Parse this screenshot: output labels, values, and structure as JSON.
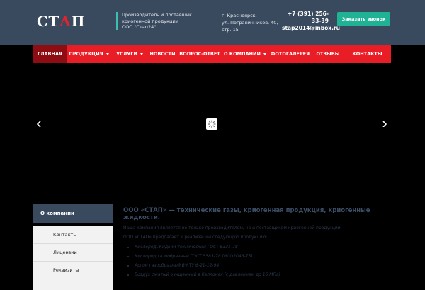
{
  "header": {
    "logo": {
      "part1": "СТ",
      "part2": "А",
      "part3": "П"
    },
    "tagline": [
      "Производитель и поставщик",
      "криогенной продукции",
      "ООО \"Стап24\""
    ],
    "address": [
      "г. Красноярск,",
      "ул. Пограничников, 40,",
      "стр. 15"
    ],
    "phone": "+7 (391) 256-33-39",
    "email": "stap2014@inbox.ru",
    "cta_label": "Заказать звонок"
  },
  "nav": {
    "items": [
      {
        "label": "Главная"
      },
      {
        "label": "Продукция"
      },
      {
        "label": "Услуги"
      },
      {
        "label": "Новости"
      },
      {
        "label": "Вопрос-ответ"
      },
      {
        "label": "О компании"
      },
      {
        "label": "Фотогалерея"
      },
      {
        "label": "Отзывы"
      },
      {
        "label": "Контакты"
      }
    ]
  },
  "slider": {
    "prev_icon": "chevron-left-icon",
    "next_icon": "chevron-right-icon",
    "loader_icon": "loading-spinner-icon"
  },
  "sidebar": {
    "title": "О компании",
    "items": [
      {
        "label": "Контакты"
      },
      {
        "label": "Лицензии"
      },
      {
        "label": "Реквизиты"
      }
    ]
  },
  "content": {
    "heading": "ООО «СТАП» — технические газы, криогенная продукция, криогенные жидкости.",
    "intro": "Наша компания является не только производителем, но и поставщиком криогенной продукции.",
    "lead": "ООО «СТАП» предлагает к реализации следующую продукцию:",
    "products": [
      "Кислород Жидкий технический ГОСТ 6331-78",
      "Кислород газообразный ГОСТ 5583-78 (ИСО2046-73)",
      "Аргон газообразный ВЧ ТУ 6-21-12-94",
      "Воздух сжатый очищенный в баллонах (с давлением до 16 МПа)"
    ]
  },
  "colors": {
    "header_bg": "#394a5f",
    "nav_bg": "#e91d25",
    "nav_active": "#8e0d12",
    "cta_bg": "#20b295",
    "accent_line": "#3bbfb0"
  }
}
